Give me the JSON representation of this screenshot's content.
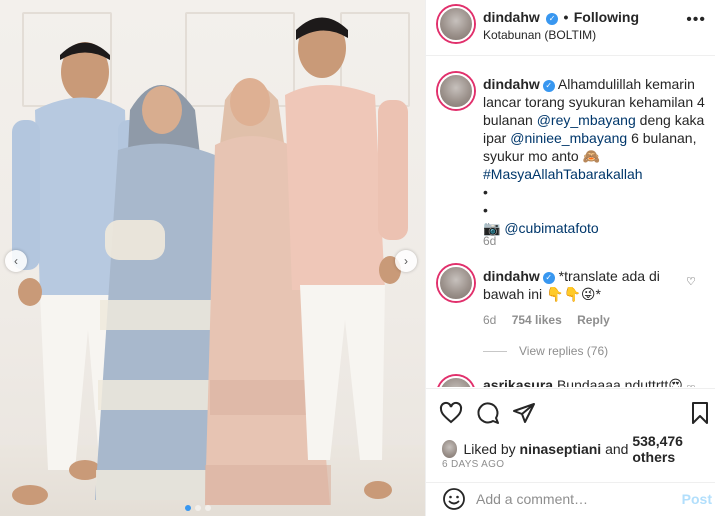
{
  "header": {
    "username": "dindahw",
    "verified_icon": "verified-badge-icon",
    "separator": "•",
    "follow_state": "Following",
    "location": "Kotabunan (BOLTIM)",
    "more_icon": "more-options-icon"
  },
  "caption": {
    "username": "dindahw",
    "text_1": "Alhamdulillah kemarin lancar torang syukuran kehamilan 4 bulanan ",
    "mention_1": "@rey_mbayang",
    "text_2": " deng kaka ipar ",
    "mention_2": "@niniee_mbayang",
    "text_3": " 6 bulanan, syukur mo anto 🙈",
    "hashtag": "#MasyaAllahTabarakallah",
    "bullet_1": "•",
    "bullet_2": "•",
    "camera": "📷",
    "credit": "@cubimatafoto",
    "time": "6d"
  },
  "comment": {
    "username": "dindahw",
    "text": "*translate ada di bawah ini 👇👇😜*",
    "time": "6d",
    "likes": "754 likes",
    "reply": "Reply",
    "view_replies": "View replies (76)"
  },
  "next_comment": {
    "username": "asrikasura",
    "text": "Bundaaaa nduttrtt😍"
  },
  "actions": {
    "like_icon": "heart-icon",
    "comment_icon": "comment-icon",
    "share_icon": "share-icon",
    "save_icon": "bookmark-icon"
  },
  "likes": {
    "prefix": "Liked by ",
    "user": "ninaseptiani",
    "middle": " and ",
    "count": "538,476 others"
  },
  "date": "6 DAYS AGO",
  "add_comment": {
    "placeholder": "Add a comment…",
    "post": "Post",
    "emoji_icon": "emoji-icon"
  },
  "carousel": {
    "prev_icon": "chevron-left-icon",
    "next_icon": "chevron-right-icon"
  },
  "colors": {
    "accent": "#3897f0",
    "link": "#00376b",
    "muted": "#8e8e8e",
    "post_disabled": "#b2dffc"
  }
}
